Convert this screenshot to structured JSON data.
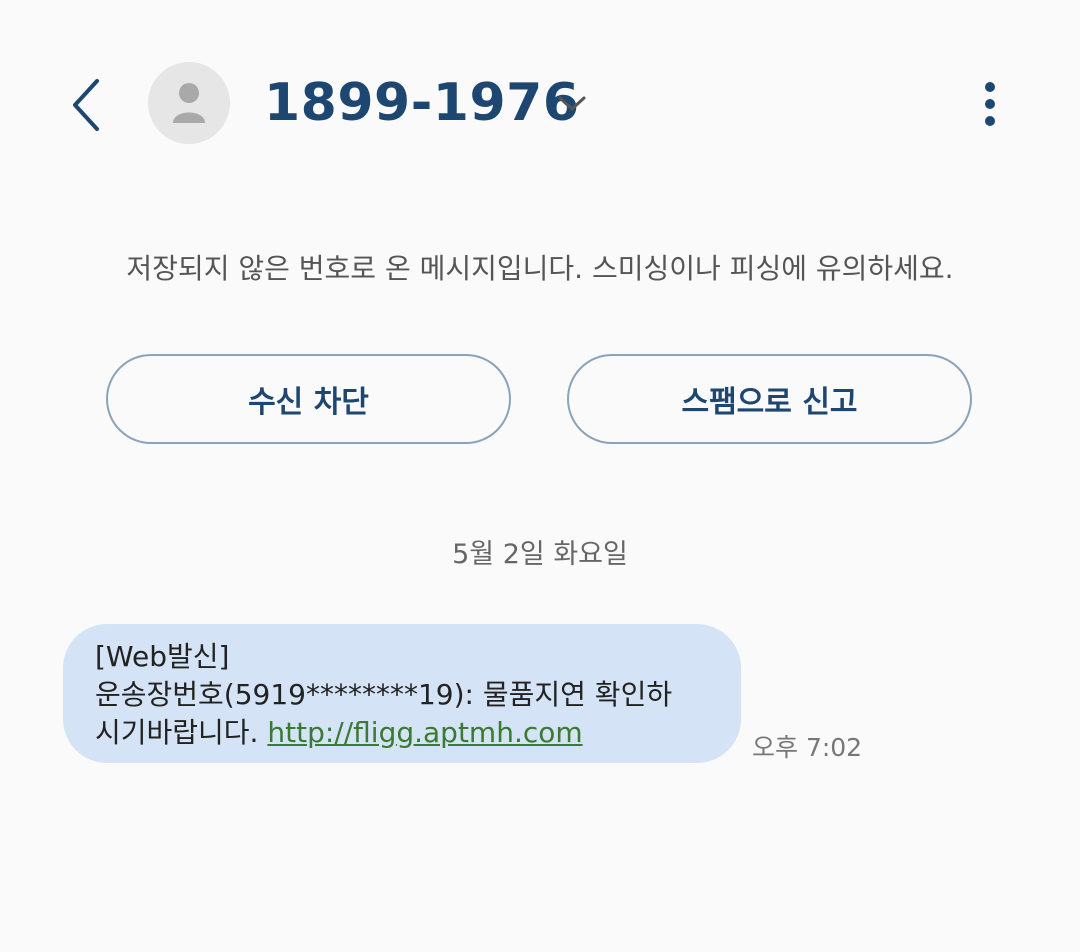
{
  "header": {
    "back_icon": "chevron-left-icon",
    "avatar_icon": "person-icon",
    "contact": "1899-1976",
    "dropdown_icon": "chevron-down-icon",
    "more_icon": "more-vertical-icon"
  },
  "warning": {
    "text": "저장되지 않은 번호로 온 메시지입니다. 스미싱이나 피싱에 유의하세요.",
    "block_button": "수신 차단",
    "spam_button": "스팸으로 신고"
  },
  "conversation": {
    "date": "5월 2일 화요일",
    "messages": [
      {
        "line1": "[Web발신]",
        "line2": "운송장번호(5919********19): 물품지연 확인하",
        "line3_text": "시기바랍니다. ",
        "link": "http://fligg.aptmh.com",
        "time": "오후 7:02"
      }
    ]
  },
  "colors": {
    "title": "#1d4670",
    "bubble": "#d4e3f5",
    "link": "#3a7a33",
    "button_border": "#8aa3bd"
  }
}
